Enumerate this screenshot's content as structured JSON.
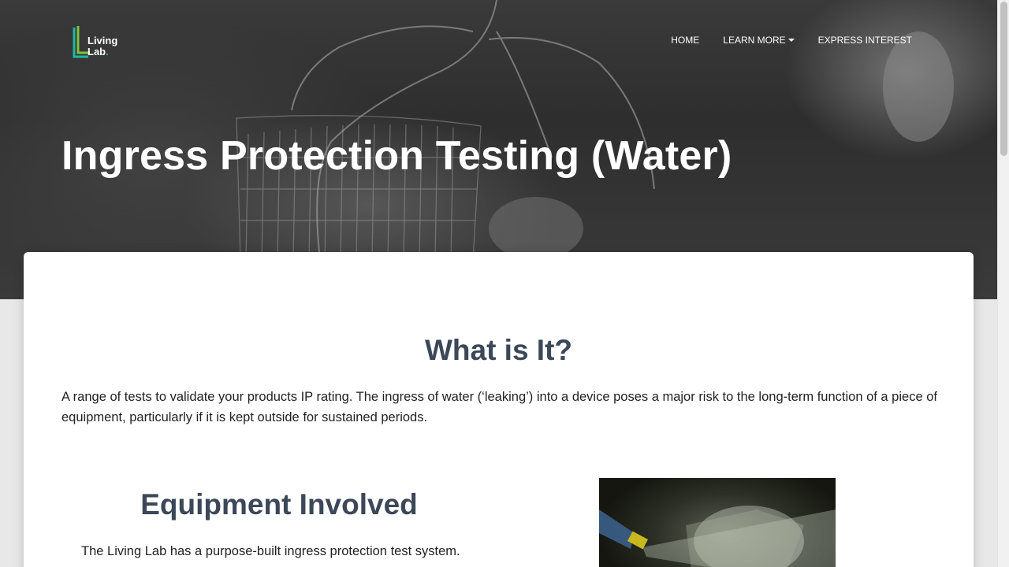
{
  "header": {
    "logo_text": "Living\nLab",
    "logo_dot": ".",
    "nav": [
      {
        "label": "HOME"
      },
      {
        "label": "LEARN MORE"
      },
      {
        "label": "EXPRESS INTEREST"
      }
    ],
    "page_title": "Ingress Protection Testing (Water)"
  },
  "main": {
    "what_title": "What is It?",
    "what_text": "A range of tests to validate your products IP rating. The ingress of water (‘leaking’) into a device poses a major risk to the long-term function of a piece of equipment, particularly if it is kept outside for sustained periods.",
    "equipment_title": "Equipment Involved",
    "equipment_text": "The Living Lab has a purpose-built ingress protection test system."
  },
  "colors": {
    "accent_teal": "#1fb8a0",
    "heading": "#3c4858"
  }
}
